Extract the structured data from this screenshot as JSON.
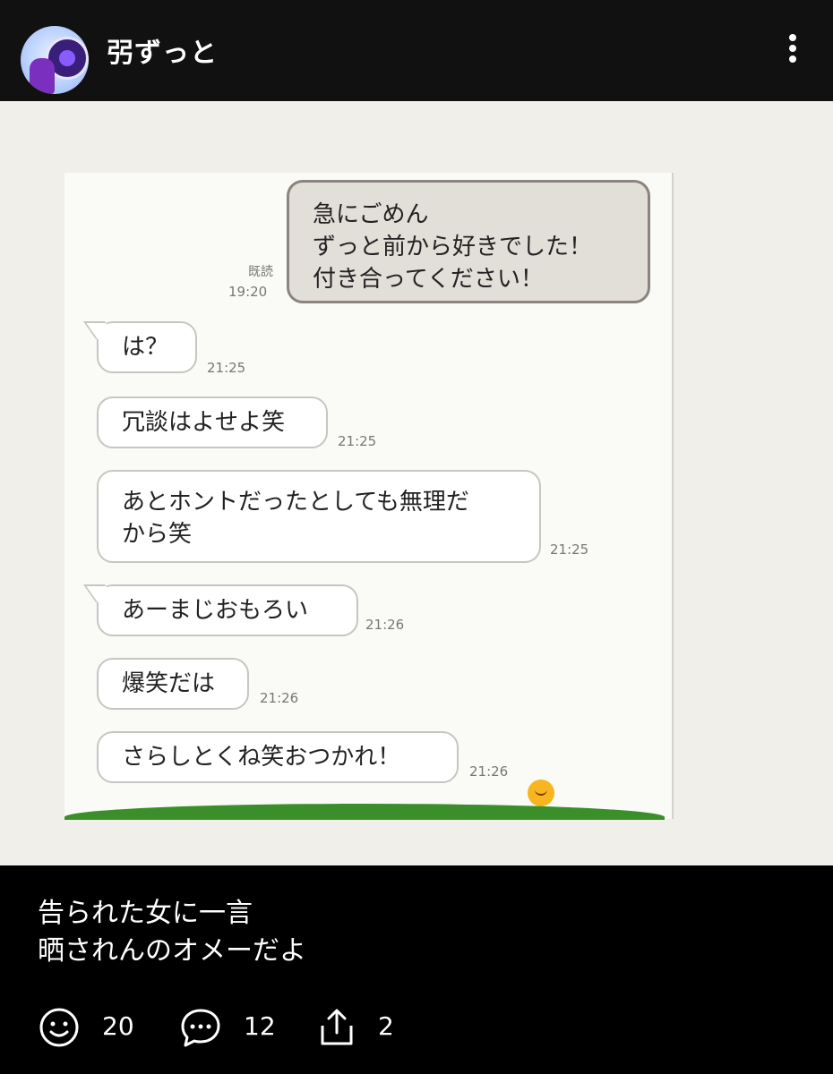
{
  "header": {
    "username": "弜ずっと",
    "avatar_icon": "avatar-icon",
    "more_icon": "more-vertical-icon"
  },
  "chat": {
    "sent": {
      "lines": [
        "急にごめん",
        "ずっと前から好きでした！",
        "付き合ってください！"
      ],
      "read_label": "既読",
      "time": "19:20"
    },
    "received": [
      {
        "lines": [
          "は？"
        ],
        "time": "21:25"
      },
      {
        "lines": [
          "冗談はよせよ笑"
        ],
        "time": "21:25"
      },
      {
        "lines": [
          "あとホントだったとしても無理だ",
          "から笑"
        ],
        "time": "21:25"
      },
      {
        "lines": [
          "あーまじおもろい"
        ],
        "time": "21:26"
      },
      {
        "lines": [
          "爆笑だは"
        ],
        "time": "21:26"
      },
      {
        "lines": [
          "さらしとくね笑おつかれ！"
        ],
        "time": "21:26"
      }
    ]
  },
  "caption": {
    "line1": "告られた女に一言",
    "line2": "晒されんのオメーだよ"
  },
  "actions": {
    "like_count": "20",
    "comment_count": "12",
    "share_count": "2"
  },
  "colors": {
    "background": "#000000",
    "header": "#111111",
    "chat_bg": "#fafaf7",
    "sent_bubble": "#e2ded8",
    "grass": "#3a8f2a"
  }
}
